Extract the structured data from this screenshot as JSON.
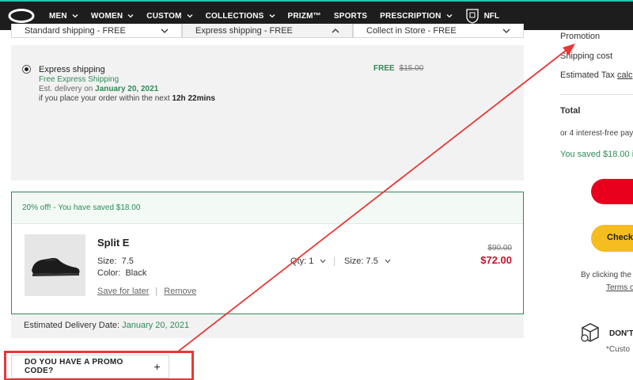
{
  "nav": {
    "items": [
      "MEN",
      "WOMEN",
      "CUSTOM",
      "COLLECTIONS",
      "PRIZM™",
      "SPORTS",
      "PRESCRIPTION",
      "NFL"
    ],
    "accent_color": "#29c4b0"
  },
  "shipping_tabs": [
    {
      "label": "Standard shipping - FREE",
      "icon": "chevron-down-icon"
    },
    {
      "label": "Express shipping - FREE",
      "icon": "chevron-up-icon"
    },
    {
      "label": "Collect in Store - FREE",
      "icon": "chevron-down-icon"
    }
  ],
  "shipping_option": {
    "title": "Express shipping",
    "free_label": "Free Express Shipping",
    "est_prefix": "Est. delivery on",
    "est_date": "January 20, 2021",
    "order_prefix": "if you place your order within the next",
    "order_time": "12h 22mins",
    "price_label": "FREE",
    "old_price": "$15.00"
  },
  "cart_item": {
    "promo_text": "20% off! - You have saved $18.00",
    "name": "Split E",
    "size_label": "Size:",
    "size_value": "7.5",
    "color_label": "Color:",
    "color_value": "Black",
    "save_later": "Save for later",
    "separator": "|",
    "remove": "Remove",
    "qty_label": "Qty:",
    "qty_value": "1",
    "size_select_label": "Size:",
    "size_select_value": "7.5",
    "old_price": "$90.00",
    "new_price": "$72.00"
  },
  "delivery": {
    "label": "Estimated Delivery Date:",
    "date": "January 20, 2021"
  },
  "promo_code": {
    "label": "DO YOU HAVE A PROMO CODE?",
    "plus": "+"
  },
  "summary": {
    "promotion": "Promotion",
    "shipping_cost": "Shipping cost",
    "estimated_tax": "Estimated Tax",
    "estimated_tax_link": "calc",
    "total": "Total",
    "installments": "or 4 interest-free pay",
    "saved": "You saved $18.00 i",
    "checkout_label": "Check o",
    "by_clicking": "By clicking the",
    "terms": "Terms o",
    "dont_title": "DON'T",
    "dont_sub": "*Custo"
  },
  "colors": {
    "green": "#2e8b57",
    "red": "#c8102e",
    "annotation_red": "#e83737",
    "checkout_yellow": "#f5bd1f",
    "paypal_red": "#e8001c"
  }
}
